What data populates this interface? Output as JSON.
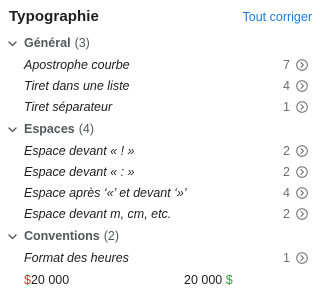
{
  "header": {
    "title": "Typographie",
    "fix_all_label": "Tout corriger"
  },
  "sections": [
    {
      "name": "Général",
      "count": "(3)",
      "items": [
        {
          "label": "Apostrophe courbe",
          "count": "7"
        },
        {
          "label": "Tiret dans une liste",
          "count": "4"
        },
        {
          "label": "Tiret séparateur",
          "count": "1"
        }
      ]
    },
    {
      "name": "Espaces",
      "count": "(4)",
      "items": [
        {
          "label": "Espace devant « ! »",
          "count": "2"
        },
        {
          "label": "Espace devant « : »",
          "count": "2"
        },
        {
          "label": "Espace après ‘«’ et devant ‘»’",
          "count": "4"
        },
        {
          "label": "Espace devant m, cm, etc.",
          "count": "2"
        }
      ]
    },
    {
      "name": "Conventions",
      "count": "(2)",
      "items": [
        {
          "label": "Format des heures",
          "count": "1"
        }
      ]
    }
  ],
  "example": {
    "before_symbol": "$",
    "before_value": "20 000",
    "after_value": "20 000",
    "after_symbol": "$"
  },
  "colors": {
    "accent": "#1f7ae0",
    "before_symbol": "#d7362b",
    "after_symbol": "#2e9b3c"
  },
  "icons": {
    "section_toggle": "chevron-down-icon",
    "item_action": "arrow-right-circle-icon"
  }
}
